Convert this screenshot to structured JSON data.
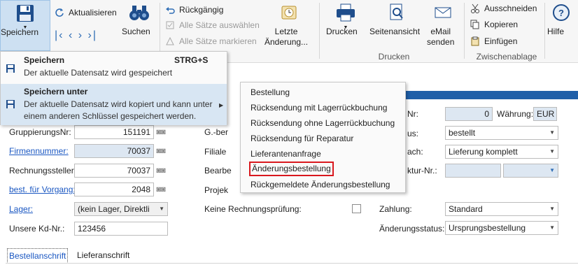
{
  "ribbon": {
    "save_label": "Speichern",
    "refresh_label": "Aktualisieren",
    "search_label": "Suchen",
    "undo_label": "Rückgängig",
    "select_all_label": "Alle Sätze auswählen",
    "mark_all_label": "Alle Sätze markieren",
    "last_change_label_1": "Letzte",
    "last_change_label_2": "Änderung...",
    "print_label": "Drucken",
    "page_view_label": "Seitenansicht",
    "email_label_1": "eMail",
    "email_label_2": "senden",
    "print_group_label": "Drucken",
    "cut_label": "Ausschneiden",
    "copy_label": "Kopieren",
    "paste_label": "Einfügen",
    "clipboard_group_label": "Zwischenablage",
    "help_label": "Hilfe"
  },
  "menu": {
    "save_title": "Speichern",
    "save_shortcut": "STRG+S",
    "save_desc": "Der aktuelle Datensatz wird gespeichert",
    "save_as_title": "Speichern unter",
    "save_as_desc": "Der aktuelle Datensatz wird kopiert und kann unter einem anderen Schlüssel gespeichert werden."
  },
  "submenu": {
    "items": [
      "Bestellung",
      "Rücksendung mit Lagerrückbuchung",
      "Rücksendung ohne Lagerrückbuchung",
      "Rücksendung für Reparatur",
      "Lieferantenanfrage",
      "Änderungsbestellung",
      "Rückgemeldete Änderungsbestellung"
    ]
  },
  "form": {
    "gruppierungsnr_label": "GruppierungsNr:",
    "gruppierungsnr_value": "151191",
    "firmennummer_label": "Firmennummer:",
    "firmennummer_value": "70037",
    "rechnungssteller_label": "Rechnungssteller:",
    "rechnungssteller_value": "70037",
    "best_vorgang_label": "best. für Vorgang:",
    "best_vorgang_value": "2048",
    "lager_label": "Lager:",
    "lager_value": "(kein Lager, Direktli",
    "kdnr_label": "Unsere Kd-Nr.:",
    "kdnr_value": "123456",
    "g_ber_label": "G.-ber",
    "filiale_label": "Filiale",
    "bearb_label": "Bearbe",
    "projekt_label": "Projek",
    "keine_rp_label": "Keine Rechnungsprüfung:",
    "nr_label": "Nr:",
    "nr_value": "0",
    "waehrung_label": "Währung:",
    "waehrung_value": "EUR",
    "status_label": "us:",
    "status_value": "bestellt",
    "ach_label": "ach:",
    "lieferung_value": "Lieferung komplett",
    "ktur_label": "ktur-Nr.:",
    "zahlung_label": "Zahlung:",
    "zahlung_value": "Standard",
    "aenderungsstatus_label": "Änderungsstatus:",
    "aenderungsstatus_value": "Ursprungsbestellung"
  },
  "tabs": {
    "bestell": "Bestellanschrift",
    "liefer": "Lieferanschrift"
  }
}
